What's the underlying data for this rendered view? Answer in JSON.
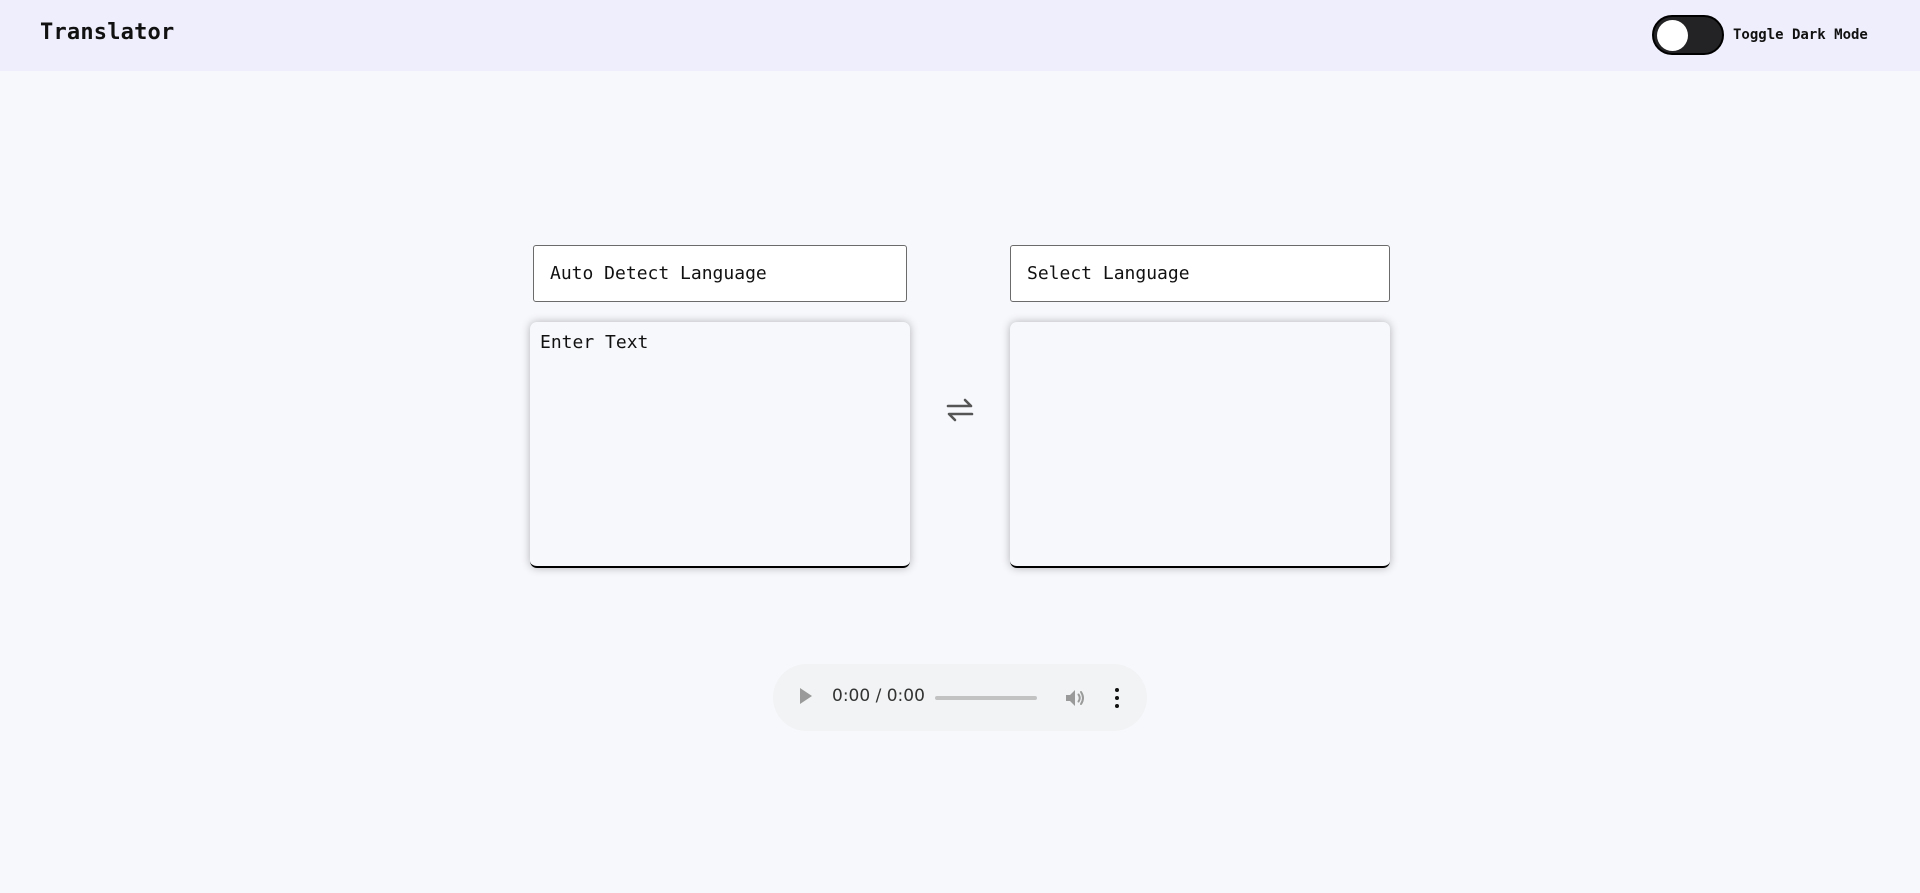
{
  "header": {
    "title": "Translator",
    "dark_mode_label": "Toggle Dark Mode"
  },
  "translator": {
    "source_language": "Auto Detect Language",
    "target_language": "Select Language",
    "source_placeholder": "Enter Text",
    "target_text": "",
    "swap_icon": "swap-arrows-icon"
  },
  "audio": {
    "time": "0:00 / 0:00",
    "icons": [
      "play-icon",
      "volume-icon",
      "more-options-icon"
    ]
  },
  "colors": {
    "header_bg": "#eeeefc",
    "page_bg": "#f7f8fc",
    "toggle_bg": "#232325"
  }
}
